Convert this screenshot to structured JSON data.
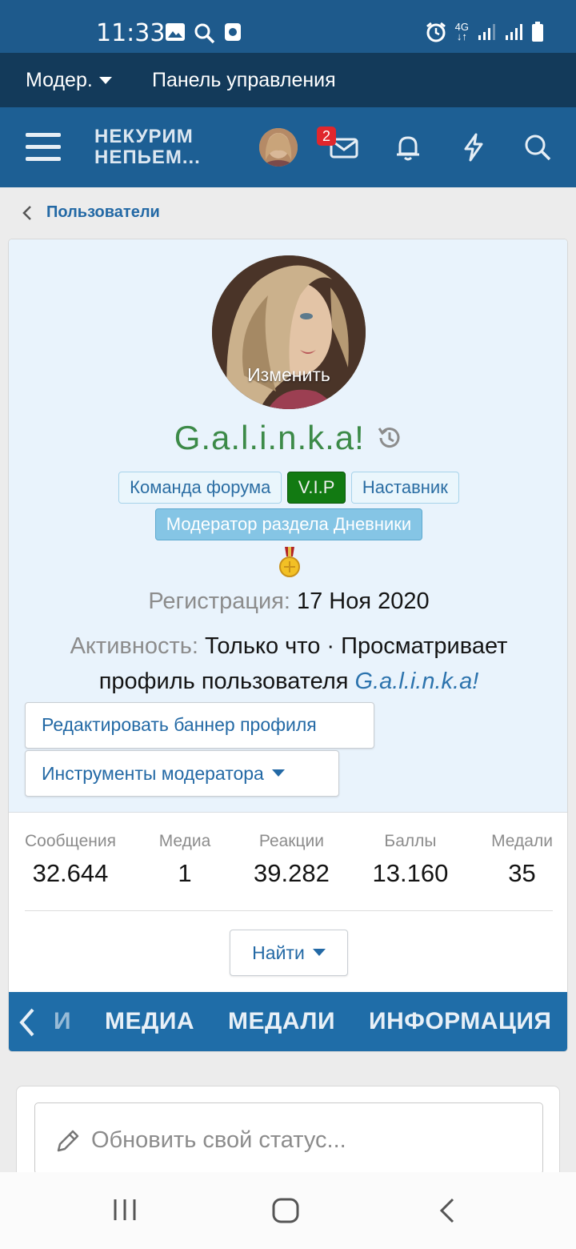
{
  "status_bar": {
    "time": "11:33",
    "network": "4G"
  },
  "staff_bar": {
    "moderator": "Модер.",
    "panel": "Панель управления"
  },
  "nav": {
    "logo_line1": "НЕКУРИМ",
    "logo_line2": "НЕПЬЕМ...",
    "inbox_badge": "2"
  },
  "breadcrumb": {
    "label": "Пользователи"
  },
  "profile": {
    "change_avatar": "Изменить",
    "username": "G.a.l.i.n.k.a!",
    "banners": [
      "Команда форума",
      "V.I.P",
      "Наставник",
      "Модератор раздела Дневники"
    ],
    "registration_label": "Регистрация:",
    "registration_value": "17 Ноя 2020",
    "activity_label": "Активность:",
    "activity_value": "Только что · Просматривает профиль пользователя",
    "activity_link": "G.a.l.i.n.k.a!",
    "edit_banner_button": "Редактировать баннер профиля",
    "mod_tools_button": "Инструменты модератора"
  },
  "stats": [
    {
      "label": "Сообщения",
      "value": "32.644"
    },
    {
      "label": "Медиа",
      "value": "1"
    },
    {
      "label": "Реакции",
      "value": "39.282"
    },
    {
      "label": "Баллы",
      "value": "13.160"
    },
    {
      "label": "Медали",
      "value": "35"
    }
  ],
  "find_button": "Найти",
  "tabs": [
    "И",
    "МЕДИА",
    "МЕДАЛИ",
    "ИНФОРМАЦИЯ"
  ],
  "status_update": {
    "placeholder": "Обновить свой статус..."
  },
  "colors": {
    "header": "#1d5f94",
    "staff_bar": "#133a5a",
    "username": "#3c8a48",
    "vip": "#127a12",
    "link": "#2369a5"
  }
}
